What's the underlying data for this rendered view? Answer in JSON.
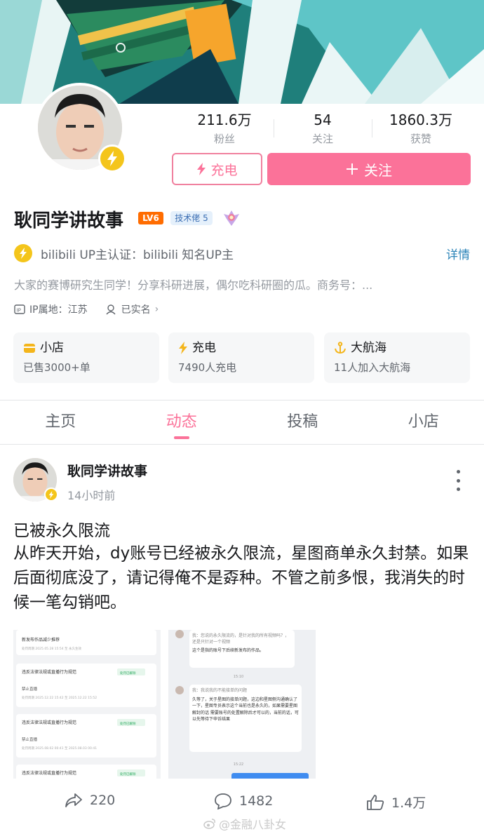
{
  "profile": {
    "followers_num": "211.6万",
    "followers_label": "粉丝",
    "following_num": "54",
    "following_label": "关注",
    "likes_num": "1860.3万",
    "likes_label": "获赞",
    "charge_label": "充电",
    "follow_label": "关注",
    "name": "耿同学讲故事",
    "level": "LV6",
    "tech_badge": "技术佬 5",
    "verify_text": "bilibili UP主认证：bilibili 知名UP主",
    "detail_label": "详情",
    "description": "大家的赛博研究生同学！分享科研进展，偶尔吃科研圈的瓜。商务号：...",
    "ip_label": "IP属地：江苏",
    "realname_label": "已实名"
  },
  "cards": [
    {
      "title": "小店",
      "sub": "已售3000+单",
      "icon": "shop-icon"
    },
    {
      "title": "充电",
      "sub": "7490人充电",
      "icon": "lightning-icon"
    },
    {
      "title": "大航海",
      "sub": "11人加入大航海",
      "icon": "anchor-icon"
    }
  ],
  "tabs": [
    {
      "label": "主页"
    },
    {
      "label": "动态",
      "active": true
    },
    {
      "label": "投稿"
    },
    {
      "label": "小店"
    }
  ],
  "post": {
    "author": "耿同学讲故事",
    "time": "14小时前",
    "title": "已被永久限流",
    "body": "从昨天开始，dy账号已经被永久限流，星图商单永久封禁。如果后面彻底没了，请记得俺不是孬种。不管之前多恨，我消失的时候一笔勾销吧。",
    "image1": {
      "rows": [
        {
          "title": "新发布作品减少推荐",
          "sub": "处罚周期 2025.05.28 15:54 至 永久生效"
        },
        {
          "title": "违反法律法规或直播行为规范",
          "tag": "处罚已解除",
          "status": "禁止直播",
          "sub": "处罚周期 2025.12.22 15:42 至 2025.12.22 15:52"
        },
        {
          "title": "违反法律法规或直播行为规范",
          "tag": "处罚已解除",
          "status": "禁止直播",
          "sub": "处罚周期 2025.08.02 00:41 至 2025.08.03 00:41"
        },
        {
          "title": "违反法律法规或直播行为规范",
          "tag": "处罚已解除"
        }
      ]
    },
    "image2": {
      "msg1": "我：您说的永久限流的，是针对我的所有视频吗？，还是只针对一个视频",
      "msg1_reply": "这个是指的账号下后续新发布的作品。",
      "time1": "15:10",
      "msg2": "我：我说我的不能接单的问题",
      "msg2_reply": "久等了，关于星图的接单问题，这边和星图侧沟通确认了一下，星图专员表示这个当前也是永久的，如果需要星图解封的话 需要账号的处置解除后才可以的，当前的话，可以先等待下申诉结果",
      "time2": "15:22"
    },
    "share_count": "220",
    "comment_count": "1482",
    "like_count": "1.4万"
  },
  "watermark": "@金融八卦女",
  "colors": {
    "accent": "#fb7299",
    "gold": "#f4c51b",
    "link": "#2d85b9"
  }
}
